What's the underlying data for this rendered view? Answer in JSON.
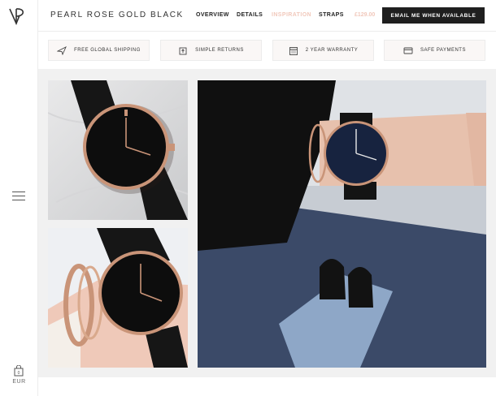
{
  "header": {
    "title": "PEARL ROSE GOLD BLACK",
    "nav": [
      "OVERVIEW",
      "DETAILS",
      "INSPIRATION",
      "STRAPS"
    ],
    "active_nav": "INSPIRATION",
    "price": "£129.00",
    "cta_label": "EMAIL ME WHEN AVAILABLE"
  },
  "sidebar": {
    "menu_icon": "hamburger-menu-icon",
    "bag_icon": "shopping-bag-icon",
    "currency": "EUR"
  },
  "features": [
    {
      "label": "FREE GLOBAL SHIPPING",
      "icon": "airplane-icon"
    },
    {
      "label": "SIMPLE RETURNS",
      "icon": "return-box-icon"
    },
    {
      "label": "2 YEAR WARRANTY",
      "icon": "calendar-icon"
    },
    {
      "label": "SAFE PAYMENTS",
      "icon": "credit-card-icon"
    }
  ],
  "colors": {
    "accent": "#f1c8bb",
    "cta_bg": "#1f1f1f",
    "rose_gold": "#c99478"
  }
}
